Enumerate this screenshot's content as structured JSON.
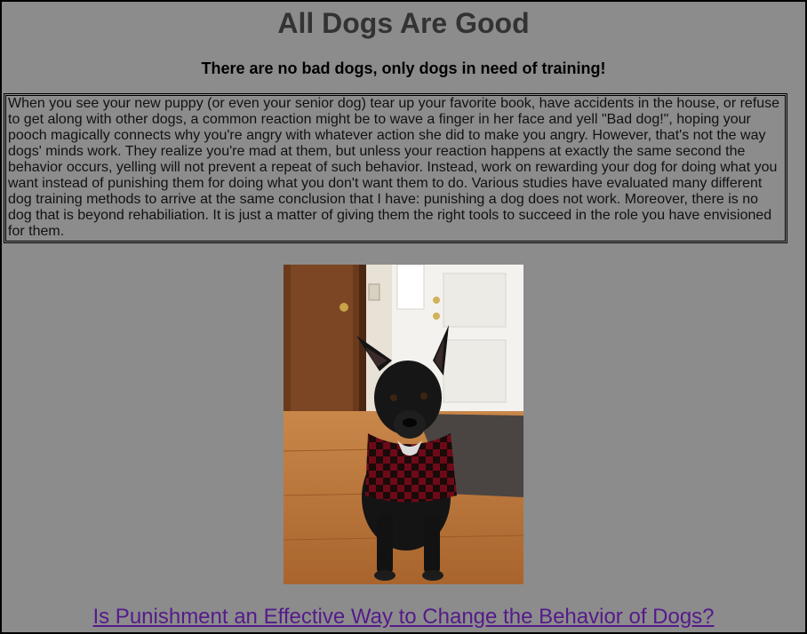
{
  "header": {
    "title": "All Dogs Are Good",
    "subtitle": "There are no bad dogs, only dogs in need of training!"
  },
  "intro": {
    "text": "When you see your new puppy (or even your senior dog) tear up your favorite book, have accidents in the house, or refuse to get along with other dogs, a common reaction might be to wave a finger in her face and yell \"Bad dog!\", hoping your pooch magically connects why you're angry with whatever action she did to make you angry. However, that's not the way dogs' minds work. They realize you're mad at them, but unless your reaction happens at exactly the same second the behavior occurs, yelling will not prevent a repeat of such behavior. Instead, work on rewarding your dog for doing what you want instead of punishing them for doing what you don't want them to do. Various studies have evaluated many different dog training methods to arrive at the same conclusion that I have: punishing a dog does not work. Moreover, there is no dog that is beyond rehabiliation. It is just a matter of giving them the right tools to succeed in the role you have envisioned for them."
  },
  "photo": {
    "subject": "black dog in red plaid sweater sitting by a door"
  },
  "links": {
    "article": "Is Punishment an Effective Way to Change the Behavior of Dogs?"
  },
  "colors": {
    "page_background": "#8c8c8c",
    "title": "#333333",
    "visited_link": "#551a8b"
  }
}
